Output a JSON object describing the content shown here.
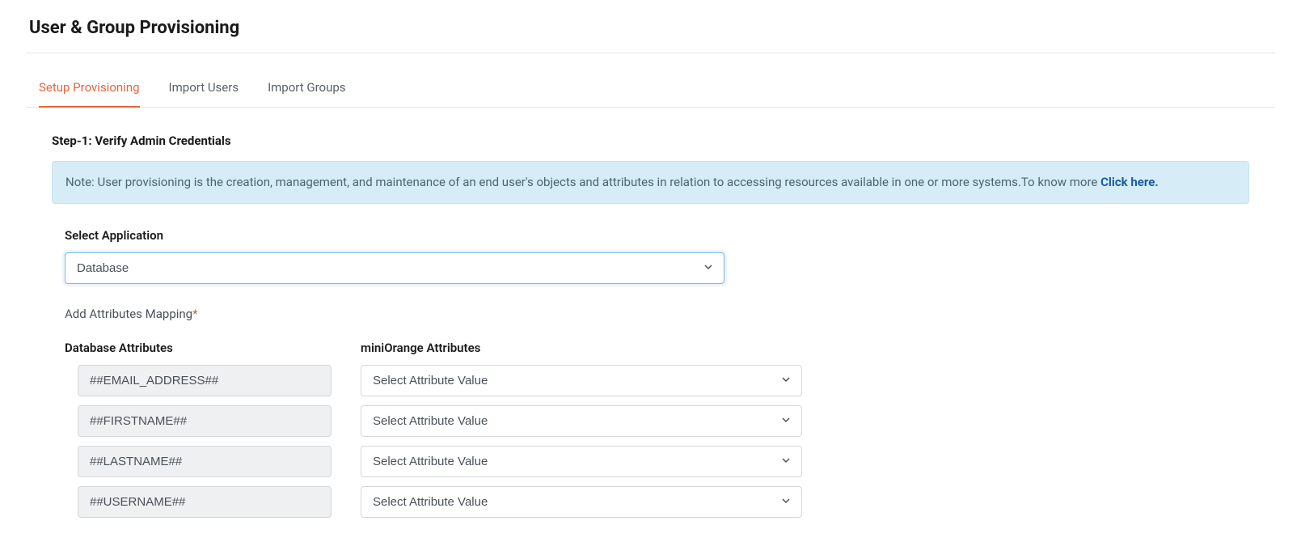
{
  "page_title": "User & Group Provisioning",
  "tabs": [
    {
      "label": "Setup Provisioning",
      "active": true
    },
    {
      "label": "Import Users",
      "active": false
    },
    {
      "label": "Import Groups",
      "active": false
    }
  ],
  "step_heading": "Step-1: Verify Admin Credentials",
  "note": {
    "text": "Note: User provisioning is the creation, management, and maintenance of an end user's objects and attributes in relation to accessing resources available in one or more systems.To know more ",
    "link_text": "Click here."
  },
  "select_application": {
    "label": "Select Application",
    "value": "Database"
  },
  "attributes_mapping_label": "Add Attributes Mapping",
  "columns": {
    "db_header": "Database Attributes",
    "mo_header": "miniOrange Attributes"
  },
  "rows": [
    {
      "db": "##EMAIL_ADDRESS##",
      "mo": "Select Attribute Value"
    },
    {
      "db": "##FIRSTNAME##",
      "mo": "Select Attribute Value"
    },
    {
      "db": "##LASTNAME##",
      "mo": "Select Attribute Value"
    },
    {
      "db": "##USERNAME##",
      "mo": "Select Attribute Value"
    }
  ]
}
